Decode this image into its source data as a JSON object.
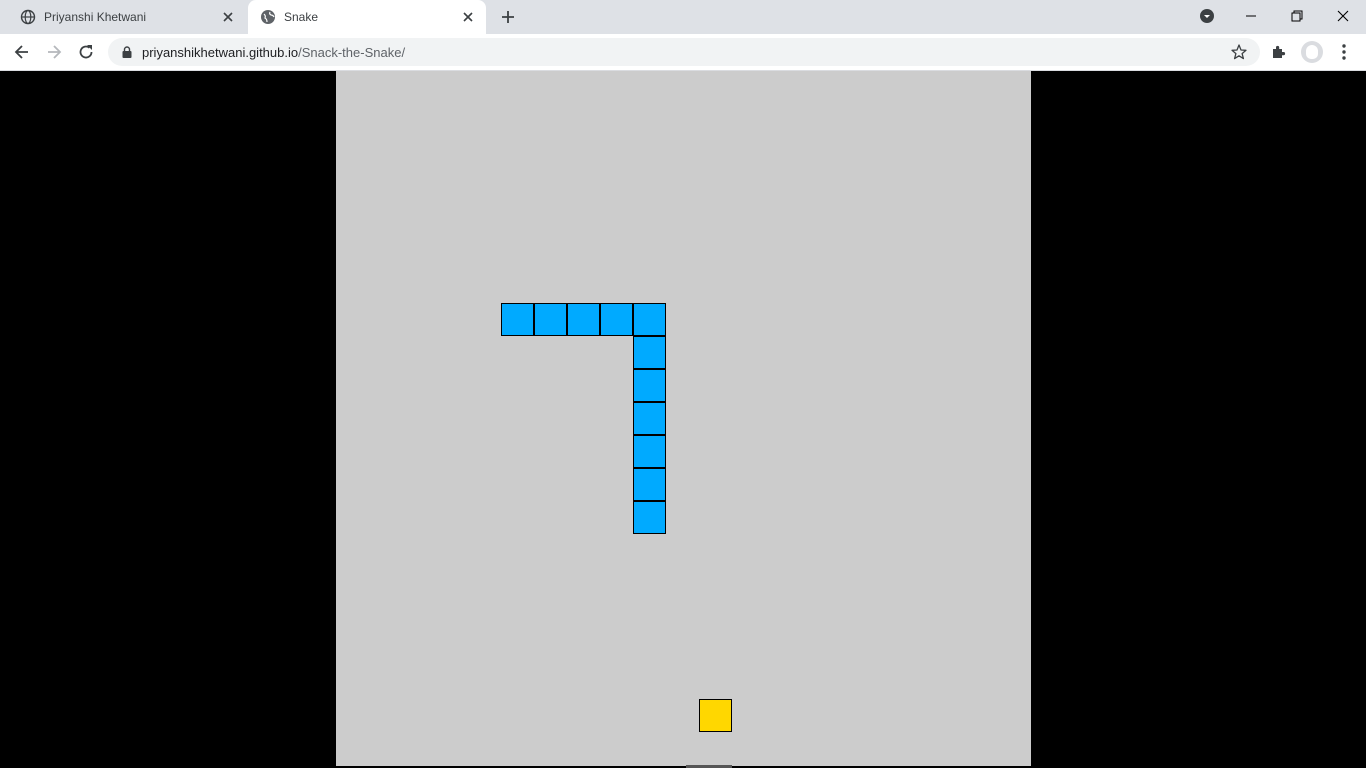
{
  "tabs": [
    {
      "title": "Priyanshi Khetwani",
      "active": false
    },
    {
      "title": "Snake",
      "active": true
    }
  ],
  "address": {
    "host": "priyanshikhetwani.github.io",
    "path": "/Snack-the-Snake/"
  },
  "colors": {
    "board": "#cccccc",
    "snake": "#00aaff",
    "food": "#ffd700",
    "page_bg": "#000000"
  },
  "game": {
    "cell_size": 33,
    "snake_cells": [
      [
        5,
        7
      ],
      [
        6,
        7
      ],
      [
        7,
        7
      ],
      [
        8,
        7
      ],
      [
        9,
        7
      ],
      [
        9,
        8
      ],
      [
        9,
        9
      ],
      [
        9,
        10
      ],
      [
        9,
        11
      ],
      [
        9,
        12
      ],
      [
        9,
        13
      ]
    ],
    "food_cell": [
      11,
      19
    ]
  },
  "icons": {
    "tab1_favicon": "globe-icon",
    "tab2_favicon": "globe-icon",
    "close": "close-icon",
    "new_tab": "plus-icon",
    "back": "back-arrow-icon",
    "forward": "forward-arrow-icon",
    "reload": "reload-icon",
    "lock": "lock-icon",
    "bookmark": "star-icon",
    "extensions": "puzzle-icon",
    "menu": "kebab-menu-icon",
    "tab_search": "tab-search-icon"
  }
}
